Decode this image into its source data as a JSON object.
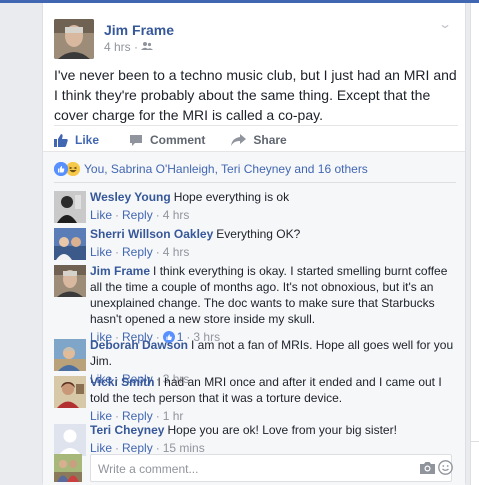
{
  "post": {
    "author": "Jim Frame",
    "time": "4 hrs · ",
    "audience_icon": "friends-icon",
    "text": "I've never been to a techno music club, but I just had an MRI and I think they're probably about the same thing. Except that the cover charge for the MRI is called a co-pay."
  },
  "actions": {
    "like": "Like",
    "comment": "Comment",
    "share": "Share"
  },
  "likes_summary": "You, Sabrina O'Hanleigh, Teri Cheyney and 16 others",
  "comments": [
    {
      "name": "Wesley Young",
      "text": "Hope everything is ok",
      "like": "Like",
      "reply": "Reply",
      "time": "4 hrs"
    },
    {
      "name": "Sherri Willson Oakley",
      "text": "Everything OK?",
      "like": "Like",
      "reply": "Reply",
      "time": "4 hrs"
    },
    {
      "name": "Jim Frame",
      "text": "I think everything is okay. I started smelling burnt coffee all the time a couple of months ago. It's not obnoxious, but it's an unexplained change. The doc wants to make sure that Starbucks hasn't opened a new store inside my skull.",
      "like": "Like",
      "reply": "Reply",
      "reactions": "1",
      "time": "3 hrs"
    },
    {
      "name": "Deborah Dawson",
      "text": "I am not a fan of MRIs. Hope all goes well for you Jim.",
      "like": "Like",
      "reply": "Reply",
      "time": "3 hrs"
    },
    {
      "name": "Vicki Smith",
      "text": "I had an MRI once and after it ended and I came out I told the tech person that it was a torture device.",
      "like": "Like",
      "reply": "Reply",
      "time": "1 hr"
    },
    {
      "name": "Teri Cheyney",
      "text": "Hope you are ok! Love from your big sister!",
      "like": "Like",
      "reply": "Reply",
      "time": "15 mins"
    }
  ],
  "write_comment": {
    "placeholder": "Write a comment..."
  },
  "colors": {
    "brand": "#4267b2",
    "link": "#365899",
    "muted": "#90949c"
  }
}
